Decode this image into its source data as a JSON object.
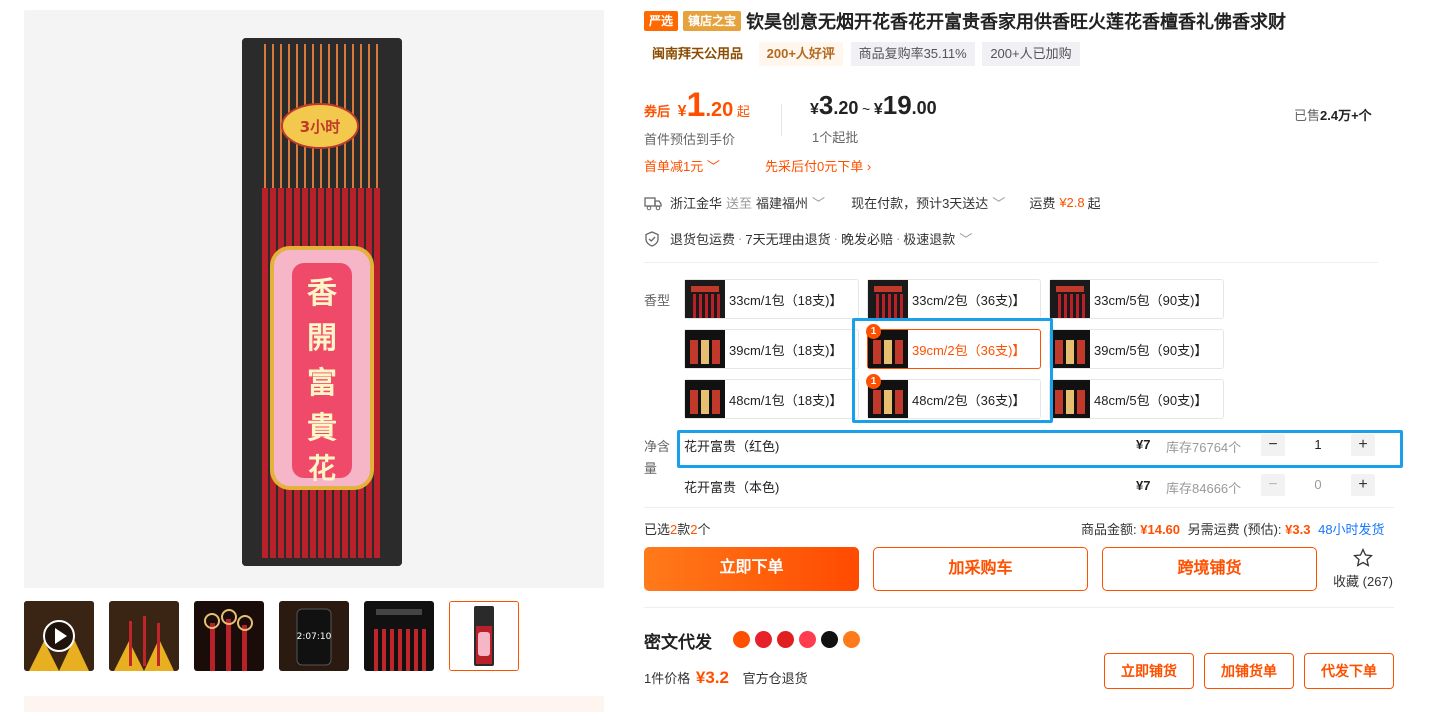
{
  "title": {
    "badge_yanxuan": "严选",
    "badge_zhendian": "镇店之宝",
    "text": "钦昊创意无烟开花香花开富贵香家用供香旺火莲花香檀香礼佛香求财"
  },
  "tags": {
    "shop": "闽南拜天公用品",
    "reviews": "200+人好评",
    "repurchase": "商品复购率35.11%",
    "added": "200+人已加购"
  },
  "price": {
    "after_coupon_label": "券后",
    "currency": "¥",
    "after_coupon_int": "1",
    "after_coupon_dec": ".20",
    "after_coupon_suffix": "起",
    "first_order_note": "首件预估到手价",
    "range_low_int": "3",
    "range_low_dec": ".20",
    "range_sep": "~",
    "range_high_int": "19",
    "range_high_dec": ".00",
    "min_batch": "1个起批",
    "sold_prefix": "已售",
    "sold_value": "2.4万+个",
    "promo_first": "首单减1元",
    "promo_paylater": "先采后付0元下单"
  },
  "shipping": {
    "from": "浙江金华",
    "to_label": "送至",
    "to": "福建福州",
    "delivery": "现在付款，预计3天送达",
    "fee_label": "运费",
    "fee": "¥2.8",
    "fee_suffix": "起"
  },
  "service": {
    "items": [
      "退货包运费",
      "7天无理由退货",
      "晚发必赔",
      "极速退款"
    ],
    "sep": "·"
  },
  "variants": {
    "label": "香型",
    "options": [
      {
        "label": "33cm/1包（18支)】",
        "count": ""
      },
      {
        "label": "33cm/2包（36支)】",
        "count": ""
      },
      {
        "label": "33cm/5包（90支)】",
        "count": ""
      },
      {
        "label": "39cm/1包（18支)】",
        "count": ""
      },
      {
        "label": "39cm/2包（36支)】",
        "count": "1"
      },
      {
        "label": "39cm/5包（90支)】",
        "count": ""
      },
      {
        "label": "48cm/1包（18支)】",
        "count": ""
      },
      {
        "label": "48cm/2包（36支)】",
        "count": "1"
      },
      {
        "label": "48cm/5包（90支)】",
        "count": ""
      }
    ]
  },
  "net": {
    "label": "净含量",
    "rows": [
      {
        "name": "花开富贵（红色)",
        "price": "¥7",
        "stock": "库存76764个",
        "qty": "1",
        "minus": "−",
        "plus": "+"
      },
      {
        "name": "花开富贵（本色)",
        "price": "¥7",
        "stock": "库存84666个",
        "qty": "0",
        "minus": "−",
        "plus": "+"
      }
    ]
  },
  "summary": {
    "selected_prefix": "已选",
    "selected_kinds": "2",
    "selected_mid": "款",
    "selected_count": "2",
    "selected_suffix": "个",
    "amount_label": "商品金额:",
    "amount": "¥14.60",
    "ship_label": "另需运费 (预估):",
    "ship_fee": "¥3.3",
    "ship_time": "48小时发货"
  },
  "actions": {
    "buy_now": "立即下单",
    "add_cart": "加采购车",
    "cross_border": "跨境铺货",
    "favorite": "收藏",
    "favorite_count": "(267)"
  },
  "dropship": {
    "title": "密文代发",
    "price_label": "1件价格",
    "price": "¥3.2",
    "return_note": "官方仓退货",
    "btn_list": "立即铺货",
    "btn_add": "加铺货单",
    "btn_order": "代发下单"
  },
  "colors": {
    "accent": "#ff5000",
    "highlight": "#1aa0e8",
    "badge_yanxuan": "#ff6a00",
    "badge_zhendian": "#e6a23c"
  }
}
